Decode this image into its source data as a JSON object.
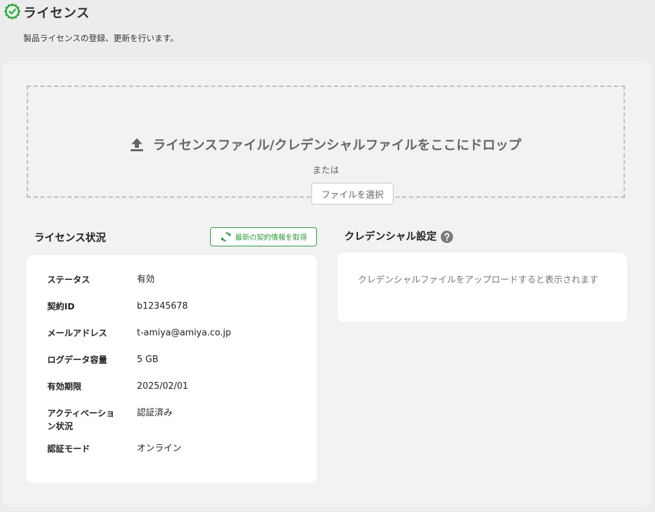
{
  "header": {
    "title": "ライセンス",
    "subtitle": "製品ライセンスの登録、更新を行います。",
    "badge_icon": "verified-badge-icon"
  },
  "dropzone": {
    "title": "ライセンスファイル/クレデンシャルファイルをここにドロップ",
    "or_text": "または",
    "select_button": "ファイルを選択",
    "icon": "upload-icon"
  },
  "license_status": {
    "heading": "ライセンス状況",
    "refresh_button": "最新の契約情報を取得",
    "refresh_icon": "refresh-icon",
    "rows": [
      {
        "label": "ステータス",
        "value": "有効"
      },
      {
        "label": "契約ID",
        "value": "b12345678"
      },
      {
        "label": "メールアドレス",
        "value": "t-amiya@amiya.co.jp"
      },
      {
        "label": "ログデータ容量",
        "value": "5 GB"
      },
      {
        "label": "有効期限",
        "value": "2025/02/01"
      },
      {
        "label": "アクティベーション状況",
        "value": "認証済み"
      },
      {
        "label": "認証モード",
        "value": "オンライン"
      }
    ]
  },
  "credential": {
    "heading": "クレデンシャル設定",
    "help_icon": "help-icon",
    "placeholder_text": "クレデンシャルファイルをアップロードすると表示されます"
  },
  "colors": {
    "accent_green": "#2e9b3e",
    "background": "#ececec",
    "panel": "#f2f2f2",
    "card": "#ffffff"
  }
}
